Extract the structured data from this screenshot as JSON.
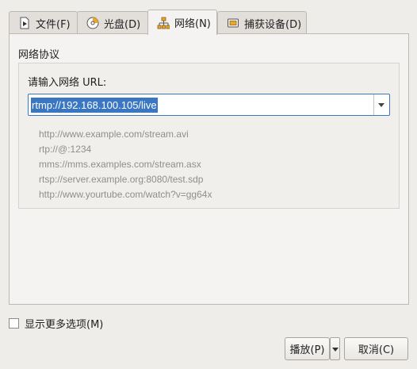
{
  "tabs": [
    {
      "label": "文件(F)",
      "icon": "file-icon"
    },
    {
      "label": "光盘(D)",
      "icon": "disc-icon"
    },
    {
      "label": "网络(N)",
      "icon": "network-icon",
      "active": true
    },
    {
      "label": "捕获设备(D)",
      "icon": "capture-device-icon"
    }
  ],
  "network": {
    "group_title": "网络协议",
    "url_label": "请输入网络 URL:",
    "url_value": "rtmp://192.168.100.105/live",
    "examples": [
      "http://www.example.com/stream.avi",
      "rtp://@:1234",
      "mms://mms.examples.com/stream.asx",
      "rtsp://server.example.org:8080/test.sdp",
      "http://www.yourtube.com/watch?v=gg64x"
    ]
  },
  "options": {
    "more_options_label": "显示更多选项(M)",
    "more_options_checked": false
  },
  "buttons": {
    "play": "播放(P)",
    "cancel": "取消(C)"
  },
  "colors": {
    "selection": "#3a77c3",
    "window_bg": "#efedea",
    "hint_text": "#8e8e8e"
  }
}
